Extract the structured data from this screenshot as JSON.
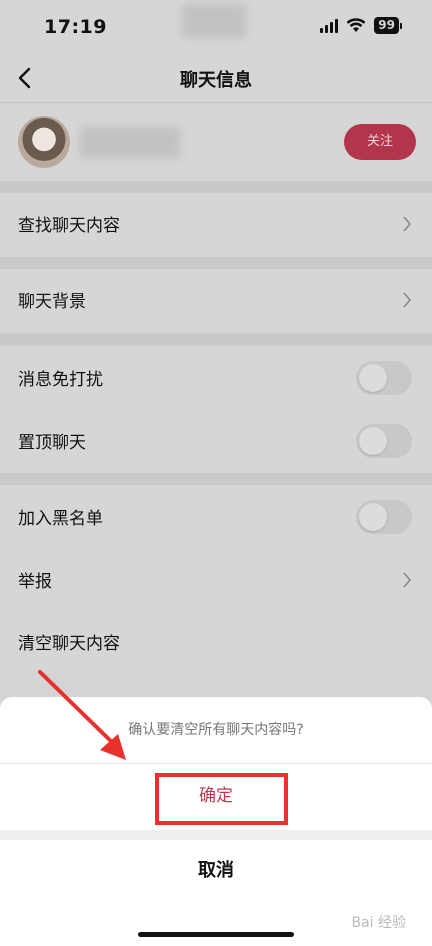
{
  "status": {
    "time": "17:19",
    "battery": "99"
  },
  "header": {
    "title": "聊天信息"
  },
  "profile": {
    "follow_label": "关注"
  },
  "settings": {
    "search": "查找聊天内容",
    "background": "聊天背景",
    "mute": "消息免打扰",
    "pin": "置顶聊天",
    "blacklist": "加入黑名单",
    "report": "举报",
    "clear": "清空聊天内容"
  },
  "sheet": {
    "prompt": "确认要清空所有聊天内容吗?",
    "confirm_label": "确定",
    "cancel_label": "取消"
  },
  "watermark": "Bai 经验",
  "colors": {
    "accent": "#b2354b",
    "confirm": "#c0384f",
    "highlight": "#e8302c"
  }
}
